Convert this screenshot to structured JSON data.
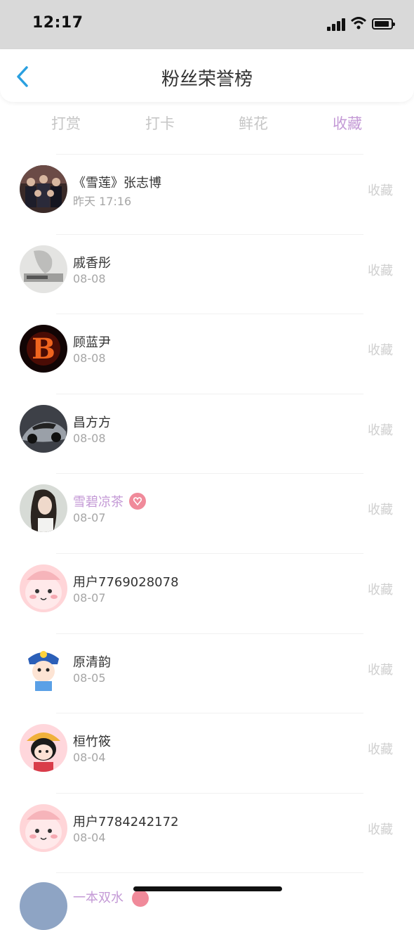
{
  "status_bar": {
    "time": "12:17"
  },
  "header": {
    "title": "粉丝荣誉榜"
  },
  "tabs": [
    {
      "label": "打赏",
      "active": false
    },
    {
      "label": "打卡",
      "active": false
    },
    {
      "label": "鲜花",
      "active": false
    },
    {
      "label": "收藏",
      "active": true
    }
  ],
  "fans": [
    {
      "name": "《雪莲》张志博",
      "date": "昨天 17:16",
      "action": "收藏",
      "vip": false,
      "avatar": "group-photo"
    },
    {
      "name": "戚香彤",
      "date": "08-08",
      "action": "收藏",
      "vip": false,
      "avatar": "gray-photo"
    },
    {
      "name": "顾蓝尹",
      "date": "08-08",
      "action": "收藏",
      "vip": false,
      "avatar": "fire-letter-b"
    },
    {
      "name": "昌方方",
      "date": "08-08",
      "action": "收藏",
      "vip": false,
      "avatar": "car-photo"
    },
    {
      "name": "雪碧凉茶",
      "date": "08-07",
      "action": "收藏",
      "vip": true,
      "avatar": "girl-photo"
    },
    {
      "name": "用户7769028078",
      "date": "08-07",
      "action": "收藏",
      "vip": false,
      "avatar": "pink-cartoon"
    },
    {
      "name": "原清韵",
      "date": "08-05",
      "action": "收藏",
      "vip": false,
      "avatar": "boy-cartoon"
    },
    {
      "name": "桓竹筱",
      "date": "08-04",
      "action": "收藏",
      "vip": false,
      "avatar": "girl-cartoon"
    },
    {
      "name": "用户7784242172",
      "date": "08-04",
      "action": "收藏",
      "vip": false,
      "avatar": "pink-cartoon"
    }
  ],
  "partial_row": {
    "name": "一本双水",
    "vip": true
  },
  "colors": {
    "accent": "#c49ad6",
    "badge": "#f08a9a",
    "back": "#2aa0e0"
  }
}
